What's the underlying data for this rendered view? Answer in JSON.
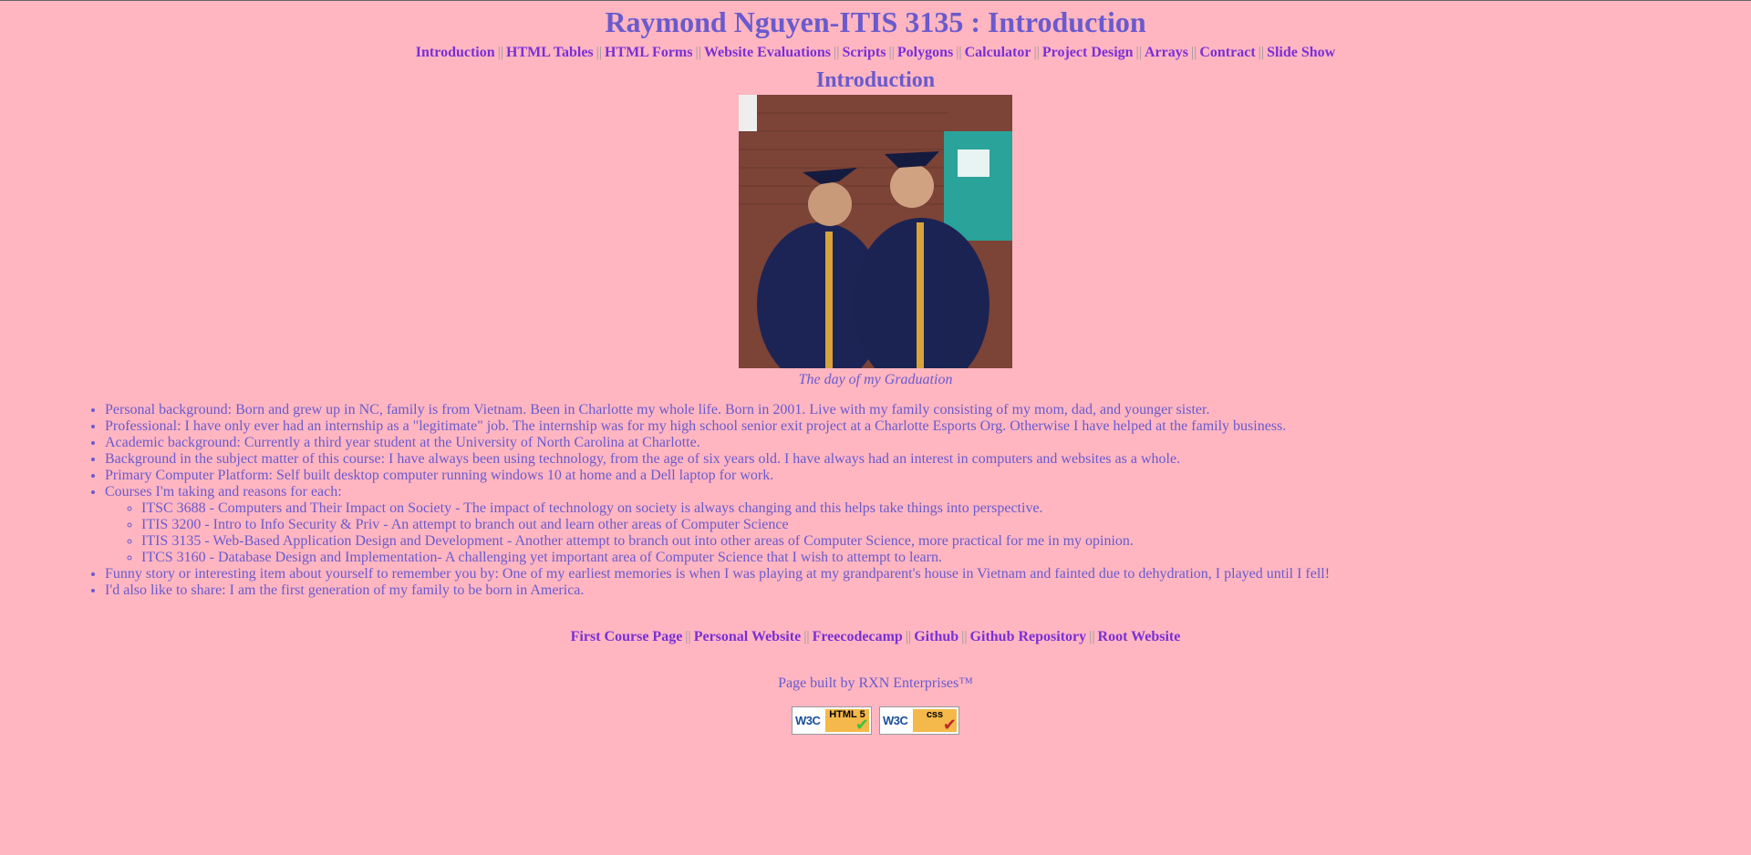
{
  "header": {
    "title": "Raymond Nguyen-ITIS 3135 : Introduction"
  },
  "nav": {
    "items": [
      "Introduction",
      "HTML Tables",
      "HTML Forms",
      "Website Evaluations",
      "Scripts",
      "Polygons",
      "Calculator",
      "Project Design",
      "Arrays",
      "Contract",
      "Slide Show"
    ],
    "separator": "||"
  },
  "main": {
    "heading": "Introduction",
    "figure": {
      "caption": "The day of my Graduation"
    },
    "bio": [
      "Personal background: Born and grew up in NC, family is from Vietnam. Been in Charlotte my whole life. Born in 2001. Live with my family consisting of my mom, dad, and younger sister.",
      "Professional: I have only ever had an internship as a \"legitimate\" job. The internship was for my high school senior exit project at a Charlotte Esports Org. Otherwise I have helped at the family business.",
      "Academic background: Currently a third year student at the University of North Carolina at Charlotte.",
      "Background in the subject matter of this course: I have always been using technology, from the age of six years old. I have always had an interest in computers and websites as a whole.",
      "Primary Computer Platform: Self built desktop computer running windows 10 at home and a Dell laptop for work."
    ],
    "courses_label": "Courses I'm taking and reasons for each:",
    "courses": [
      "ITSC 3688 - Computers and Their Impact on Society - The impact of technology on society is always changing and this helps take things into perspective.",
      "ITIS 3200 - Intro to Info Security & Priv - An attempt to branch out and learn other areas of Computer Science",
      "ITIS 3135 - Web-Based Application Design and Development - Another attempt to branch out into other areas of Computer Science, more practical for me in my opinion.",
      "ITCS 3160 - Database Design and Implementation- A challenging yet important area of Computer Science that I wish to attempt to learn."
    ],
    "funny": "Funny story or interesting item about yourself to remember you by: One of my earliest memories is when I was playing at my grandparent's house in Vietnam and fainted due to dehydration, I played until I fell!",
    "share": "I'd also like to share: I am the first generation of my family to be born in America."
  },
  "footer": {
    "links": [
      "First Course Page",
      "Personal Website",
      "Freecodecamp",
      "Github",
      "Github Repository",
      "Root Website"
    ],
    "built_by": "Page built by RXN Enterprises™",
    "badges": {
      "html": {
        "w3c": "W3C",
        "tag": "HTML 5"
      },
      "css": {
        "w3c": "W3C",
        "tag": "css"
      }
    }
  },
  "colors": {
    "background": "#ffb6c1",
    "text": "#6a5acd",
    "link": "#7b2fd6"
  }
}
